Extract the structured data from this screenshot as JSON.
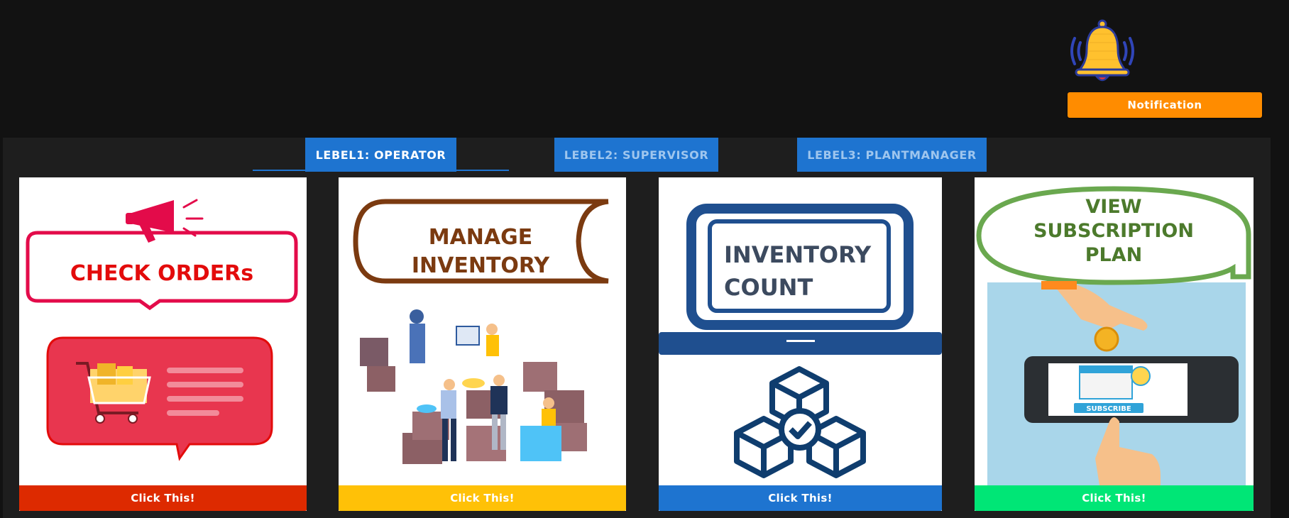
{
  "header": {
    "bell_icon": "bell-icon",
    "notification_label": "Notification",
    "notification_color": "#ff8c00"
  },
  "tabs": [
    {
      "label": "LEBEL1: OPERATOR",
      "active": true
    },
    {
      "label": "LEBEL2: SUPERVISOR",
      "active": false
    },
    {
      "label": "LEBEL3: PLANTMANAGER",
      "active": false
    }
  ],
  "cards": [
    {
      "graphic_text": "CHECK ORDERs",
      "button_label": "Click This!",
      "button_color": "#dd2a00"
    },
    {
      "graphic_text_line1": "MANAGE",
      "graphic_text_line2": "INVENTORY",
      "button_label": "Click This!",
      "button_color": "#ffc107"
    },
    {
      "graphic_text_line1": "INVENTORY",
      "graphic_text_line2": "COUNT",
      "button_label": "Click This!",
      "button_color": "#1e74d0"
    },
    {
      "graphic_text_line1": "VIEW",
      "graphic_text_line2": "SUBSCRIPTION",
      "graphic_text_line3": "PLAN",
      "graphic_badge": "SUBSCRIBE",
      "button_label": "Click This!",
      "button_color": "#00e676"
    }
  ]
}
